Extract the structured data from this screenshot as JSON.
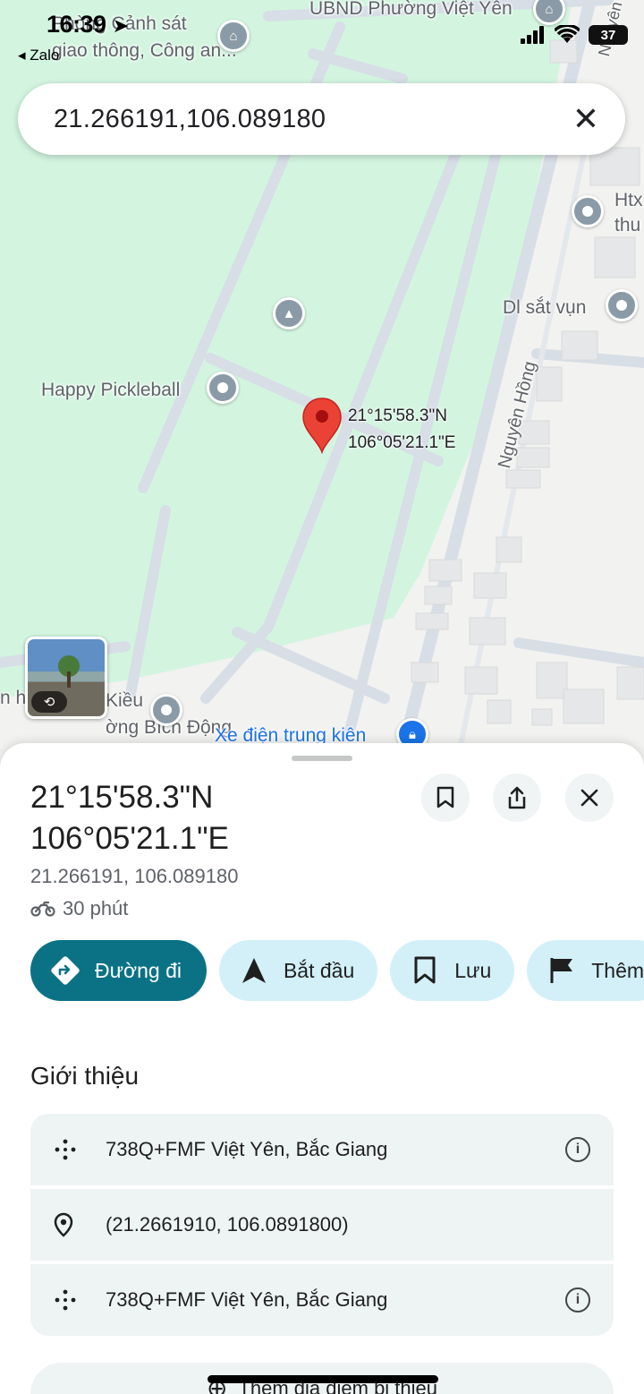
{
  "status_bar": {
    "time": "16:39",
    "back_app": "◂ Zalo",
    "battery": "37"
  },
  "search": {
    "query": "21.266191,106.089180"
  },
  "map": {
    "labels": {
      "police": "Phòng Cảnh sát\ngiao thông, Công an...",
      "ubnd": "UBND Phường Việt Yên",
      "happy_pickleball": "Happy Pickleball",
      "dl_sat_vun": "Dl sắt vụn",
      "htx": "Htx\nthu",
      "nguyen_hong_upper": "Nguyên Hồng",
      "nguyen_hong": "Nguyên Hồng",
      "kieu": "Kiều\nờng Bích Động",
      "kieu_prefix": "n h",
      "xe_dien": "Xe điện trung kiên"
    },
    "pin_label": "21°15'58.3\"N\n106°05'21.1\"E"
  },
  "place": {
    "title_line1": "21°15'58.3\"N",
    "title_line2": "106°05'21.1\"E",
    "decimal": "21.266191, 106.089180",
    "travel_time": "30 phút"
  },
  "actions": {
    "directions": "Đường đi",
    "start": "Bắt đầu",
    "save": "Lưu",
    "more": "Thêm"
  },
  "about": {
    "title": "Giới thiệu",
    "rows": [
      {
        "text": "738Q+FMF Việt Yên, Bắc Giang",
        "icon": "plus-code-icon",
        "info": "i"
      },
      {
        "text": "(21.2661910, 106.0891800)",
        "icon": "location-pin-icon"
      },
      {
        "text": "738Q+FMF Việt Yên, Bắc Giang",
        "icon": "plus-code-icon",
        "info": "i"
      }
    ]
  },
  "add_place": {
    "label": "Thêm địa điểm bị thiếu"
  },
  "colors": {
    "primary": "#0b7285",
    "chip": "#d3f0f8",
    "pin": "#ea4335",
    "park": "#d3f5e0"
  }
}
